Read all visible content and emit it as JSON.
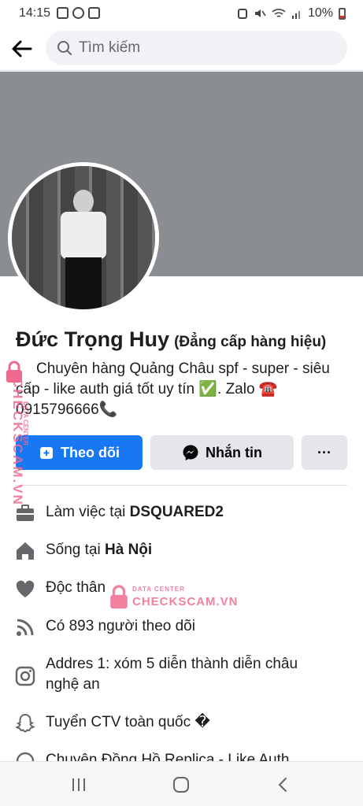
{
  "status_bar": {
    "time": "14:15",
    "battery": "10%"
  },
  "top_bar": {
    "search_placeholder": "Tìm kiếm"
  },
  "profile": {
    "name": "Đức Trọng Huy",
    "alternate_name": "(Đẳng cấp hàng hiệu)",
    "bio_line1": "Chuyên hàng Quảng Châu spf - super - siêu",
    "bio_line2": "cấp - like auth giá tốt uy tín ✅. Zalo ☎️",
    "bio_line3": "0915796666📞"
  },
  "actions": {
    "follow_label": "Theo dõi",
    "message_label": "Nhắn tin",
    "more_label": "···",
    "follow_color": "#1877f2"
  },
  "info": {
    "work_prefix": "Làm việc tại ",
    "work_place": "DSQUARED2",
    "live_prefix": "Sống tại ",
    "live_place": "Hà Nội",
    "relationship": "Độc thân",
    "followers": "Có 893 người theo dõi",
    "address_line1": "Addres 1: xóm 5 diễn thành diễn châu",
    "address_line2": "nghệ an",
    "snapchat": "Tuyển CTV toàn quốc �",
    "partial_row": "Chuyên Đồng Hồ Replica - Like Auth"
  },
  "watermark": {
    "vertical_text": "CHECKSCAM.VN",
    "vertical_small": "DATA CENTER",
    "center_top": "DATA CENTER",
    "center_main": "CHECKSCAM.VN",
    "color": "#f06a8f"
  },
  "icons": {
    "back": "arrow-left-icon",
    "search": "search-icon",
    "work": "briefcase-icon",
    "home": "home-icon",
    "heart": "heart-icon",
    "followers": "rss-icon",
    "instagram": "instagram-icon",
    "snapchat": "snapchat-icon"
  }
}
